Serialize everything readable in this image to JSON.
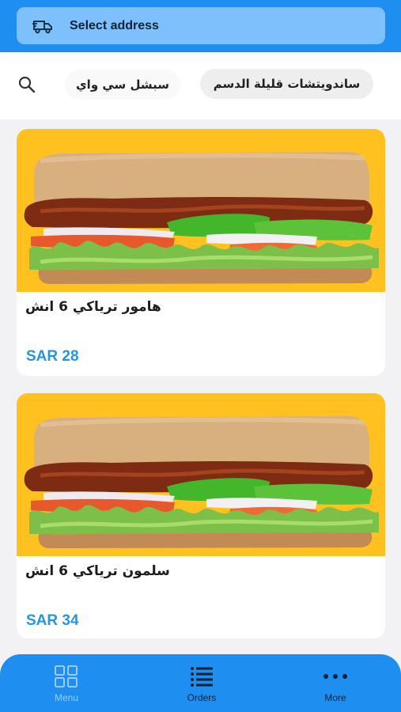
{
  "header": {
    "address_label": "Select address"
  },
  "filters": {
    "chips": [
      {
        "label": "سبشل سي واي"
      },
      {
        "label": "ساندويتشات قليلة الدسم"
      }
    ]
  },
  "products": [
    {
      "name": "هامور ترياكي 6 انش",
      "price": "SAR 28"
    },
    {
      "name": "سلمون ترياكي 6 انش",
      "price": "SAR 34"
    }
  ],
  "bottom_nav": {
    "items": [
      {
        "label": "Menu",
        "icon": "grid-icon",
        "active": true
      },
      {
        "label": "Orders",
        "icon": "list-icon",
        "active": false
      },
      {
        "label": "More",
        "icon": "more-dots-icon",
        "active": false
      }
    ]
  },
  "colors": {
    "primary": "#1e8ff0",
    "address_bar": "#7ec0fb",
    "price": "#2496dd",
    "image_background": "#fec120"
  }
}
